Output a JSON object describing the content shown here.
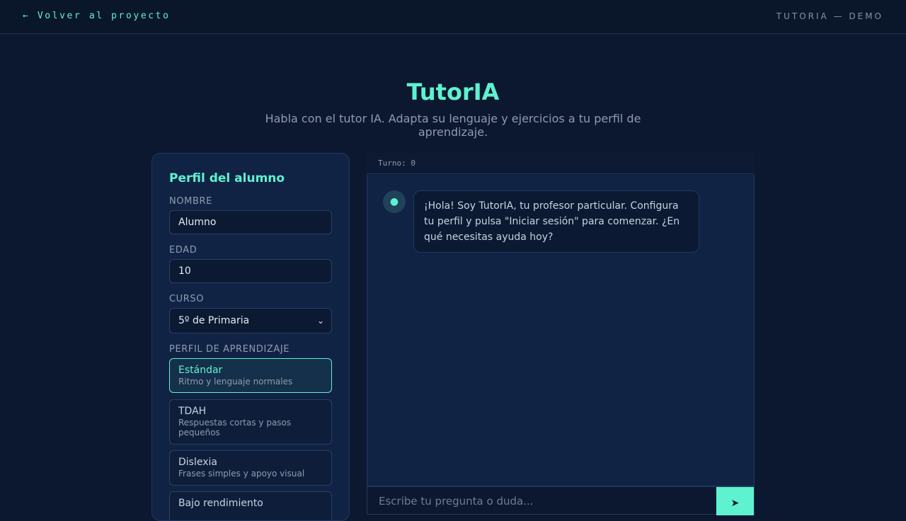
{
  "header": {
    "back_link": "← Volver al proyecto",
    "brand_tag": "TUTORIA — DEMO"
  },
  "page": {
    "title": "TutorIA",
    "subtitle": "Habla con el tutor IA. Adapta su lenguaje y ejercicios a tu perfil de aprendizaje."
  },
  "profile": {
    "title": "Perfil del alumno",
    "name_label": "NOMBRE",
    "name_value": "Alumno",
    "age_label": "EDAD",
    "age_value": "10",
    "course_label": "CURSO",
    "course_value": "5º de Primaria",
    "learning_label": "PERFIL DE APRENDIZAJE",
    "options": [
      {
        "title": "Estándar",
        "desc": "Ritmo y lenguaje normales",
        "active": true
      },
      {
        "title": "TDAH",
        "desc": "Respuestas cortas y pasos pequeños",
        "active": false
      },
      {
        "title": "Dislexia",
        "desc": "Frases simples y apoyo visual",
        "active": false
      },
      {
        "title": "Bajo rendimiento",
        "desc": "",
        "active": false
      }
    ]
  },
  "chat": {
    "turn_label": "Turno: 0",
    "avatar_icon": "robot-icon",
    "messages": [
      {
        "role": "bot",
        "text": "¡Hola! Soy TutorIA, tu profesor particular. Configura tu perfil y pulsa \"Iniciar sesión\" para comenzar. ¿En qué necesitas ayuda hoy?"
      }
    ],
    "input_placeholder": "Escribe tu pregunta o duda...",
    "send_icon": "➤"
  },
  "colors": {
    "accent": "#5ef2d0",
    "background": "#0b1830",
    "panel": "#112345"
  }
}
